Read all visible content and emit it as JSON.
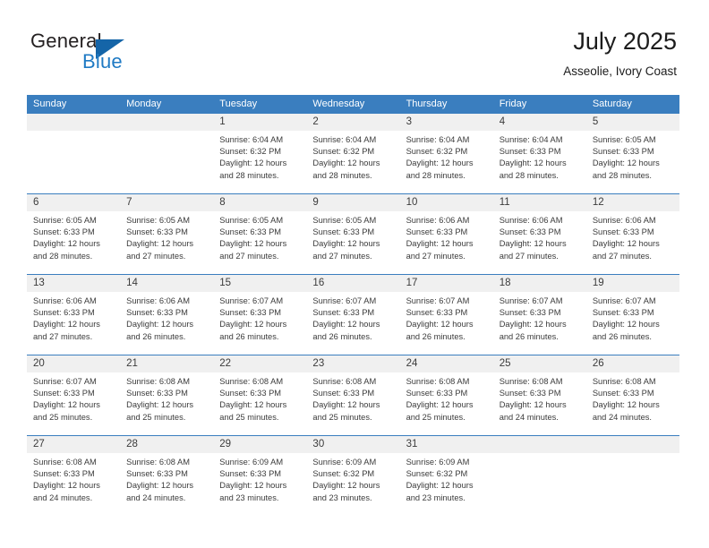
{
  "brand": {
    "name_top": "General",
    "name_bottom": "Blue",
    "accent_color": "#1f7ac4",
    "triangle_color": "#1565a8",
    "logo_icon": "blue-triangle-icon"
  },
  "header": {
    "title": "July 2025",
    "subtitle": "Asseolie, Ivory Coast"
  },
  "theme": {
    "header_blue": "#3a7ebf",
    "daynum_gray": "#f0f0f0",
    "text": "#3b3b3b"
  },
  "weekdays": [
    "Sunday",
    "Monday",
    "Tuesday",
    "Wednesday",
    "Thursday",
    "Friday",
    "Saturday"
  ],
  "weeks": [
    {
      "days": [
        {
          "num": "",
          "sunrise": "",
          "sunset": "",
          "daylight": ""
        },
        {
          "num": "",
          "sunrise": "",
          "sunset": "",
          "daylight": ""
        },
        {
          "num": "1",
          "sunrise": "Sunrise: 6:04 AM",
          "sunset": "Sunset: 6:32 PM",
          "daylight": "Daylight: 12 hours and 28 minutes."
        },
        {
          "num": "2",
          "sunrise": "Sunrise: 6:04 AM",
          "sunset": "Sunset: 6:32 PM",
          "daylight": "Daylight: 12 hours and 28 minutes."
        },
        {
          "num": "3",
          "sunrise": "Sunrise: 6:04 AM",
          "sunset": "Sunset: 6:32 PM",
          "daylight": "Daylight: 12 hours and 28 minutes."
        },
        {
          "num": "4",
          "sunrise": "Sunrise: 6:04 AM",
          "sunset": "Sunset: 6:33 PM",
          "daylight": "Daylight: 12 hours and 28 minutes."
        },
        {
          "num": "5",
          "sunrise": "Sunrise: 6:05 AM",
          "sunset": "Sunset: 6:33 PM",
          "daylight": "Daylight: 12 hours and 28 minutes."
        }
      ]
    },
    {
      "days": [
        {
          "num": "6",
          "sunrise": "Sunrise: 6:05 AM",
          "sunset": "Sunset: 6:33 PM",
          "daylight": "Daylight: 12 hours and 28 minutes."
        },
        {
          "num": "7",
          "sunrise": "Sunrise: 6:05 AM",
          "sunset": "Sunset: 6:33 PM",
          "daylight": "Daylight: 12 hours and 27 minutes."
        },
        {
          "num": "8",
          "sunrise": "Sunrise: 6:05 AM",
          "sunset": "Sunset: 6:33 PM",
          "daylight": "Daylight: 12 hours and 27 minutes."
        },
        {
          "num": "9",
          "sunrise": "Sunrise: 6:05 AM",
          "sunset": "Sunset: 6:33 PM",
          "daylight": "Daylight: 12 hours and 27 minutes."
        },
        {
          "num": "10",
          "sunrise": "Sunrise: 6:06 AM",
          "sunset": "Sunset: 6:33 PM",
          "daylight": "Daylight: 12 hours and 27 minutes."
        },
        {
          "num": "11",
          "sunrise": "Sunrise: 6:06 AM",
          "sunset": "Sunset: 6:33 PM",
          "daylight": "Daylight: 12 hours and 27 minutes."
        },
        {
          "num": "12",
          "sunrise": "Sunrise: 6:06 AM",
          "sunset": "Sunset: 6:33 PM",
          "daylight": "Daylight: 12 hours and 27 minutes."
        }
      ]
    },
    {
      "days": [
        {
          "num": "13",
          "sunrise": "Sunrise: 6:06 AM",
          "sunset": "Sunset: 6:33 PM",
          "daylight": "Daylight: 12 hours and 27 minutes."
        },
        {
          "num": "14",
          "sunrise": "Sunrise: 6:06 AM",
          "sunset": "Sunset: 6:33 PM",
          "daylight": "Daylight: 12 hours and 26 minutes."
        },
        {
          "num": "15",
          "sunrise": "Sunrise: 6:07 AM",
          "sunset": "Sunset: 6:33 PM",
          "daylight": "Daylight: 12 hours and 26 minutes."
        },
        {
          "num": "16",
          "sunrise": "Sunrise: 6:07 AM",
          "sunset": "Sunset: 6:33 PM",
          "daylight": "Daylight: 12 hours and 26 minutes."
        },
        {
          "num": "17",
          "sunrise": "Sunrise: 6:07 AM",
          "sunset": "Sunset: 6:33 PM",
          "daylight": "Daylight: 12 hours and 26 minutes."
        },
        {
          "num": "18",
          "sunrise": "Sunrise: 6:07 AM",
          "sunset": "Sunset: 6:33 PM",
          "daylight": "Daylight: 12 hours and 26 minutes."
        },
        {
          "num": "19",
          "sunrise": "Sunrise: 6:07 AM",
          "sunset": "Sunset: 6:33 PM",
          "daylight": "Daylight: 12 hours and 26 minutes."
        }
      ]
    },
    {
      "days": [
        {
          "num": "20",
          "sunrise": "Sunrise: 6:07 AM",
          "sunset": "Sunset: 6:33 PM",
          "daylight": "Daylight: 12 hours and 25 minutes."
        },
        {
          "num": "21",
          "sunrise": "Sunrise: 6:08 AM",
          "sunset": "Sunset: 6:33 PM",
          "daylight": "Daylight: 12 hours and 25 minutes."
        },
        {
          "num": "22",
          "sunrise": "Sunrise: 6:08 AM",
          "sunset": "Sunset: 6:33 PM",
          "daylight": "Daylight: 12 hours and 25 minutes."
        },
        {
          "num": "23",
          "sunrise": "Sunrise: 6:08 AM",
          "sunset": "Sunset: 6:33 PM",
          "daylight": "Daylight: 12 hours and 25 minutes."
        },
        {
          "num": "24",
          "sunrise": "Sunrise: 6:08 AM",
          "sunset": "Sunset: 6:33 PM",
          "daylight": "Daylight: 12 hours and 25 minutes."
        },
        {
          "num": "25",
          "sunrise": "Sunrise: 6:08 AM",
          "sunset": "Sunset: 6:33 PM",
          "daylight": "Daylight: 12 hours and 24 minutes."
        },
        {
          "num": "26",
          "sunrise": "Sunrise: 6:08 AM",
          "sunset": "Sunset: 6:33 PM",
          "daylight": "Daylight: 12 hours and 24 minutes."
        }
      ]
    },
    {
      "days": [
        {
          "num": "27",
          "sunrise": "Sunrise: 6:08 AM",
          "sunset": "Sunset: 6:33 PM",
          "daylight": "Daylight: 12 hours and 24 minutes."
        },
        {
          "num": "28",
          "sunrise": "Sunrise: 6:08 AM",
          "sunset": "Sunset: 6:33 PM",
          "daylight": "Daylight: 12 hours and 24 minutes."
        },
        {
          "num": "29",
          "sunrise": "Sunrise: 6:09 AM",
          "sunset": "Sunset: 6:33 PM",
          "daylight": "Daylight: 12 hours and 23 minutes."
        },
        {
          "num": "30",
          "sunrise": "Sunrise: 6:09 AM",
          "sunset": "Sunset: 6:32 PM",
          "daylight": "Daylight: 12 hours and 23 minutes."
        },
        {
          "num": "31",
          "sunrise": "Sunrise: 6:09 AM",
          "sunset": "Sunset: 6:32 PM",
          "daylight": "Daylight: 12 hours and 23 minutes."
        },
        {
          "num": "",
          "sunrise": "",
          "sunset": "",
          "daylight": ""
        },
        {
          "num": "",
          "sunrise": "",
          "sunset": "",
          "daylight": ""
        }
      ]
    }
  ]
}
